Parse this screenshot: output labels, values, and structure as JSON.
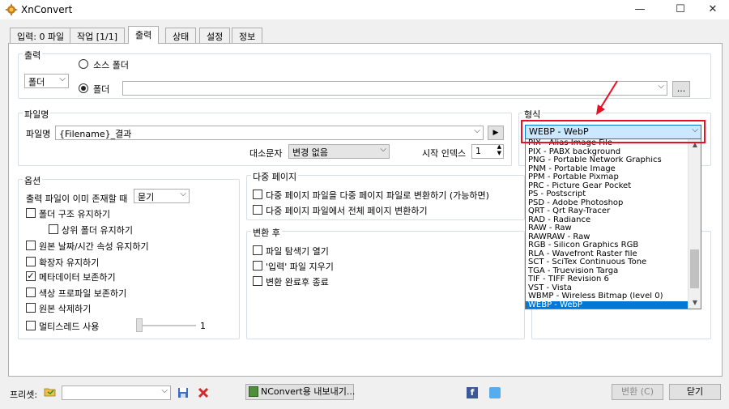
{
  "window": {
    "title": "XnConvert",
    "minimize": "—",
    "maximize": "☐",
    "close": "✕"
  },
  "tabs": [
    {
      "label": "입력: 0 파일"
    },
    {
      "label": "작업 [1/1]"
    },
    {
      "label": "출력"
    },
    {
      "label": "상태"
    },
    {
      "label": "설정"
    },
    {
      "label": "정보"
    }
  ],
  "output": {
    "group_label": "출력",
    "destination_select": "폴더",
    "source_folder_label": "소스 폴더",
    "folder_label": "폴더",
    "folder_path": "",
    "browse_label": "..."
  },
  "filename": {
    "group_label": "파일명",
    "label": "파일명",
    "value": "{Filename}_결과",
    "case_label": "대소문자",
    "case_value": "변경 없음",
    "start_index_label": "시작 인덱스",
    "start_index_value": "1"
  },
  "format": {
    "group_label": "형식",
    "selected": "WEBP - WebP",
    "options": [
      "PIX - Alias Image File",
      "PIX - PABX background",
      "PNG - Portable Network Graphics",
      "PNM - Portable Image",
      "PPM - Portable Pixmap",
      "PRC - Picture Gear Pocket",
      "PS - Postscript",
      "PSD - Adobe Photoshop",
      "QRT - Qrt Ray-Tracer",
      "RAD - Radiance",
      "RAW - Raw",
      "RAWRAW - Raw",
      "RGB - Silicon Graphics RGB",
      "RLA - Wavefront Raster file",
      "SCT - SciTex Continuous Tone",
      "TGA - Truevision Targa",
      "TIF - TIFF Revision 6",
      "VST - Vista",
      "WBMP - Wireless Bitmap (level 0)",
      "WEBP - WebP"
    ],
    "highlight_color": "#e81123",
    "selection_color": "#0078d7"
  },
  "options": {
    "group_label": "옵션",
    "if_exists_label": "출력 파일이 이미 존재할 때",
    "if_exists_value": "묻기",
    "items": [
      {
        "label": "폴더 구조 유지하기",
        "checked": false
      },
      {
        "label": "상위 폴더 유지하기",
        "checked": false
      },
      {
        "label": "원본 날짜/시간 속성 유지하기",
        "checked": false
      },
      {
        "label": "확장자 유지하기",
        "checked": false
      },
      {
        "label": "메타데이터 보존하기",
        "checked": true
      },
      {
        "label": "색상 프로파일 보존하기",
        "checked": false
      },
      {
        "label": "원본 삭제하기",
        "checked": false
      },
      {
        "label": "멀티스레드 사용",
        "checked": false
      }
    ],
    "thread_value": "1"
  },
  "multipage": {
    "group_label": "다중 페이지",
    "items": [
      {
        "label": "다중 페이지 파일을 다중 페이지 파일로 변환하기 (가능하면)",
        "checked": false
      },
      {
        "label": "다중 페이지 파일에서 전체 페이지 변환하기",
        "checked": false
      }
    ]
  },
  "after": {
    "group_label": "변환 후",
    "items": [
      {
        "label": "파일 탐색기 열기",
        "checked": false
      },
      {
        "label": "'입력' 파일 지우기",
        "checked": false
      },
      {
        "label": "변환 완료후 종료",
        "checked": false
      }
    ]
  },
  "bottom": {
    "preset_label": "프리셋:",
    "preset_value": "",
    "export_label": "NConvert용 내보내기...",
    "convert_label": "변환 (C)",
    "close_label": "닫기"
  }
}
